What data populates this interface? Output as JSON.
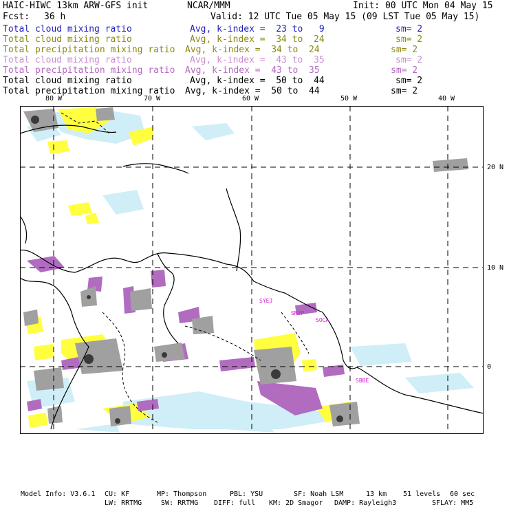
{
  "header": {
    "model_title": "HAIC-HIWC 13km ARW-GFS init",
    "org": "NCAR/MMM",
    "init": "Init: 00 UTC Mon 04 May 15",
    "fcst_label": "Fcst:",
    "fcst_value": "36 h",
    "valid": "Valid: 12 UTC Tue 05 May 15 (09 LST Tue 05 May 15)"
  },
  "legend": [
    {
      "field": "Total cloud mixing ratio",
      "avg": "Avg, k-index =  23 to   9",
      "sm": "sm= 2",
      "color": "#1f1fbf"
    },
    {
      "field": "Total cloud mixing ratio",
      "avg": "Avg, k-index =  34 to  24",
      "sm": "sm= 2",
      "color": "#8a8a10"
    },
    {
      "field": "Total precipitation mixing ratio",
      "avg": "Avg, k-index =  34 to  24",
      "sm": "sm= 2",
      "color": "#8a8a10"
    },
    {
      "field": "Total cloud mixing ratio",
      "avg": "Avg, k-index =  43 to  35",
      "sm": "sm= 2",
      "color": "#c98fd0"
    },
    {
      "field": "Total precipitation mixing ratio",
      "avg": "Avg, k-index =  43 to  35",
      "sm": "sm= 2",
      "color": "#b46bc0"
    },
    {
      "field": "Total cloud mixing ratio",
      "avg": "Avg, k-index =  50 to  44",
      "sm": "sm= 2",
      "color": "#000000"
    },
    {
      "field": "Total precipitation mixing ratio",
      "avg": "Avg, k-index =  50 to  44",
      "sm": "sm= 2",
      "color": "#000000"
    }
  ],
  "map": {
    "lon_labels": [
      "80 W",
      "70 W",
      "60 W",
      "50 W",
      "40 W"
    ],
    "lat_labels": [
      "20 N",
      "10 N",
      "0"
    ],
    "station_labels": [
      "SYEJ",
      "SMJP",
      "SOCA",
      "SBBE"
    ],
    "station_color": "#d21ad2",
    "colors": {
      "yellow": "#ffff40",
      "light_blue": "#cfeef8",
      "purple": "#b16cc0",
      "gray": "#a0a0a0",
      "dark": "#3a3a3a"
    }
  },
  "footer": {
    "line1": [
      "Model Info: V3.6.1",
      "CU: KF",
      "MP: Thompson",
      "PBL: YSU",
      "SF: Noah LSM",
      "13 km",
      "51 levels",
      "60 sec"
    ],
    "line2": [
      "LW: RRTMG",
      "SW: RRTMG",
      "DIFF: full",
      "KM: 2D Smagor",
      "DAMP: Rayleigh3",
      "SFLAY: MM5"
    ]
  }
}
